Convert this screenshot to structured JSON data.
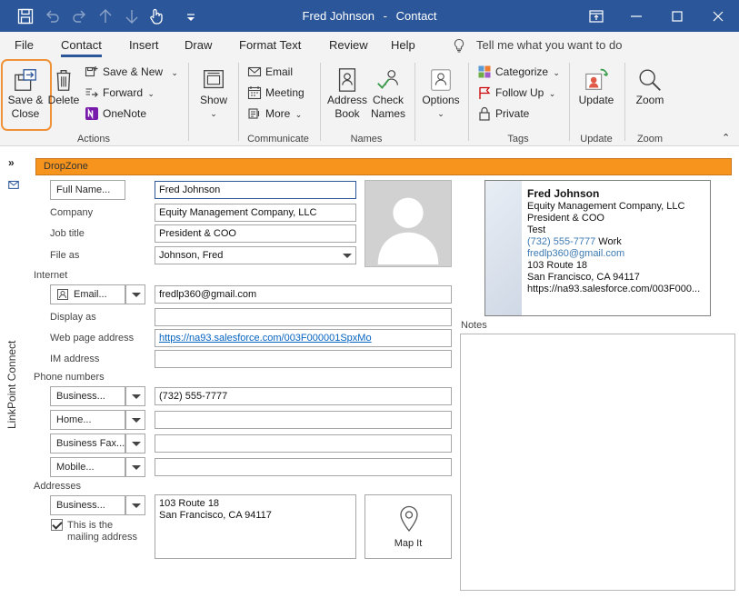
{
  "window": {
    "title_name": "Fred Johnson",
    "title_sep": "-",
    "title_app": "Contact"
  },
  "tabs": [
    "File",
    "Contact",
    "Insert",
    "Draw",
    "Format Text",
    "Review",
    "Help"
  ],
  "tell_me": "Tell me what you want to do",
  "ribbon": {
    "actions": {
      "save_close_line1": "Save &",
      "save_close_line2": "Close",
      "delete": "Delete",
      "save_new": "Save & New",
      "forward": "Forward",
      "onenote": "OneNote",
      "group": "Actions"
    },
    "show": {
      "label": "Show"
    },
    "communicate": {
      "email": "Email",
      "meeting": "Meeting",
      "more": "More",
      "group": "Communicate"
    },
    "names": {
      "address_line1": "Address",
      "address_line2": "Book",
      "check_line1": "Check",
      "check_line2": "Names",
      "group": "Names"
    },
    "options": {
      "label": "Options"
    },
    "tags": {
      "categorize": "Categorize",
      "follow_up": "Follow Up",
      "private": "Private",
      "group": "Tags"
    },
    "update": {
      "label": "Update",
      "group": "Update"
    },
    "zoom": {
      "label": "Zoom",
      "group": "Zoom"
    }
  },
  "side_pane": {
    "label": "LinkPoint Connect"
  },
  "dropzone": "DropZone",
  "form": {
    "full_name_btn": "Full Name...",
    "full_name": "Fred Johnson",
    "company_label": "Company",
    "company": "Equity Management Company, LLC",
    "job_title_label": "Job title",
    "job_title": "President & COO",
    "file_as_label": "File as",
    "file_as": "Johnson, Fred",
    "internet_section": "Internet",
    "email_btn": "Email...",
    "email": "fredlp360@gmail.com",
    "display_as_label": "Display as",
    "display_as": "",
    "web_label": "Web page address",
    "web": "https://na93.salesforce.com/003F000001SpxMo",
    "im_label": "IM address",
    "im": "",
    "phone_section": "Phone numbers",
    "phones": [
      {
        "type": "Business...",
        "value": "(732) 555-7777"
      },
      {
        "type": "Home...",
        "value": ""
      },
      {
        "type": "Business Fax...",
        "value": ""
      },
      {
        "type": "Mobile...",
        "value": ""
      }
    ],
    "addresses_section": "Addresses",
    "address_type": "Business...",
    "address_line1": "103 Route 18",
    "address_line2": "San Francisco, CA  94117",
    "mailing_line1": "This is the",
    "mailing_line2": "mailing address",
    "map_it": "Map It",
    "notes_label": "Notes"
  },
  "business_card": {
    "name": "Fred Johnson",
    "company": "Equity Management Company, LLC",
    "title": "President & COO",
    "dept": "Test",
    "phone": "(732) 555-7777",
    "phone_type": "Work",
    "email": "fredlp360@gmail.com",
    "street": "103 Route 18",
    "city": "San Francisco, CA  94117",
    "web": "https://na93.salesforce.com/003F000..."
  },
  "colors": {
    "title_bar": "#2b579a",
    "dropzone": "#f7941d",
    "highlight": "#f0923a",
    "link": "#0563c1"
  }
}
